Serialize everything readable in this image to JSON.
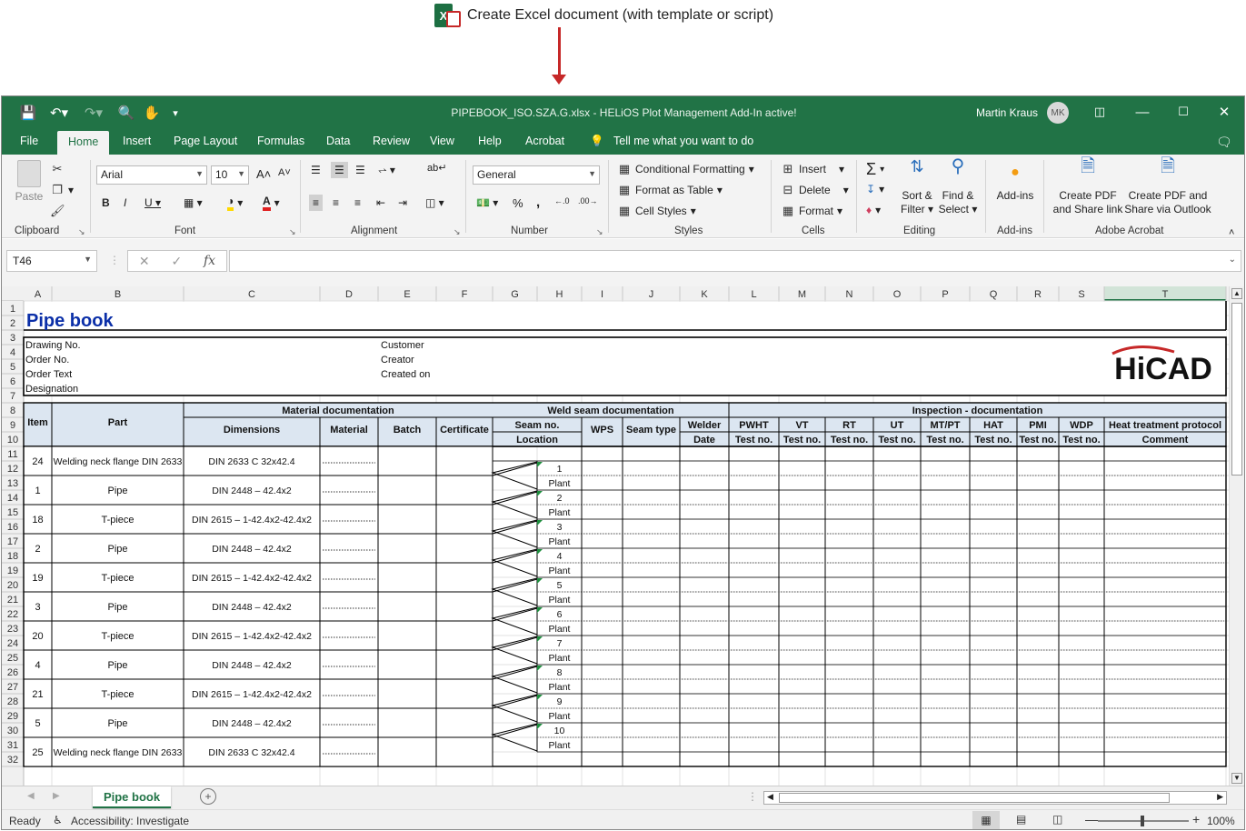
{
  "caption": {
    "text": "Create Excel document (with template or script)",
    "icon": "excel-icon"
  },
  "window": {
    "title": "PIPEBOOK_ISO.SZA.G.xlsx  -  HELiOS Plot Management Add-In active!",
    "user": "Martin Kraus",
    "avatar": "MK"
  },
  "tabs": [
    "File",
    "Home",
    "Insert",
    "Page Layout",
    "Formulas",
    "Data",
    "Review",
    "View",
    "Help",
    "Acrobat"
  ],
  "active_tab": "Home",
  "tell_me": "Tell me what you want to do",
  "ribbon": {
    "clipboard": {
      "label": "Clipboard",
      "paste": "Paste"
    },
    "font": {
      "label": "Font",
      "name": "Arial",
      "size": "10"
    },
    "alignment": {
      "label": "Alignment"
    },
    "number": {
      "label": "Number",
      "format": "General"
    },
    "styles": {
      "label": "Styles",
      "conditional": "Conditional Formatting",
      "format_table": "Format as Table",
      "cell_styles": "Cell Styles"
    },
    "cells": {
      "label": "Cells",
      "insert": "Insert",
      "delete": "Delete",
      "format": "Format"
    },
    "editing": {
      "label": "Editing",
      "sort_1": "Sort &",
      "sort_2": "Filter",
      "find_1": "Find &",
      "find_2": "Select"
    },
    "addins": {
      "label": "Add-ins",
      "button": "Add-ins"
    },
    "acrobat": {
      "label": "Adobe Acrobat",
      "pdf_share_1": "Create PDF",
      "pdf_share_2": "and Share link",
      "pdf_outlook_1": "Create PDF and",
      "pdf_outlook_2": "Share via Outlook"
    }
  },
  "formula_bar": {
    "name_box": "T46",
    "formula": ""
  },
  "columns": [
    "A",
    "B",
    "C",
    "D",
    "E",
    "F",
    "G",
    "H",
    "I",
    "J",
    "K",
    "L",
    "M",
    "N",
    "O",
    "P",
    "Q",
    "R",
    "S",
    "T"
  ],
  "selected_column": "T",
  "sheet": {
    "title": "Pipe book",
    "header_left": [
      "Drawing No.",
      "Order No.",
      "Order Text",
      "Designation"
    ],
    "header_right": [
      "Customer",
      "Creator",
      "Created on"
    ],
    "logo": "HiCAD",
    "group_headers": {
      "material": "Material documentation",
      "weld": "Weld seam documentation",
      "inspection": "Inspection - documentation"
    },
    "col_item": "Item",
    "col_part": "Part",
    "col_dimensions": "Dimensions",
    "col_material": "Material",
    "col_batch": "Batch",
    "col_certificate": "Certificate",
    "col_seam_no": "Seam no.",
    "col_location": "Location",
    "col_wps": "WPS",
    "col_seam_type": "Seam type",
    "col_welder": "Welder",
    "col_date": "Date",
    "inspections": [
      "PWHT",
      "VT",
      "RT",
      "UT",
      "MT/PT",
      "HAT",
      "PMI",
      "WDP"
    ],
    "test_no": "Test no.",
    "heat_treatment": "Heat treatment protocol",
    "comment": "Comment",
    "items": [
      {
        "item": "24",
        "part": "Welding neck flange DIN 2633",
        "dim": "DIN 2633 C 32x42.4"
      },
      {
        "item": "1",
        "part": "Pipe",
        "dim": "DIN 2448 – 42.4x2"
      },
      {
        "item": "18",
        "part": "T-piece",
        "dim": "DIN 2615 – 1-42.4x2-42.4x2"
      },
      {
        "item": "2",
        "part": "Pipe",
        "dim": "DIN 2448 – 42.4x2"
      },
      {
        "item": "19",
        "part": "T-piece",
        "dim": "DIN 2615 – 1-42.4x2-42.4x2"
      },
      {
        "item": "3",
        "part": "Pipe",
        "dim": "DIN 2448 – 42.4x2"
      },
      {
        "item": "20",
        "part": "T-piece",
        "dim": "DIN 2615 – 1-42.4x2-42.4x2"
      },
      {
        "item": "4",
        "part": "Pipe",
        "dim": "DIN 2448 – 42.4x2"
      },
      {
        "item": "21",
        "part": "T-piece",
        "dim": "DIN 2615 – 1-42.4x2-42.4x2"
      },
      {
        "item": "5",
        "part": "Pipe",
        "dim": "DIN 2448 – 42.4x2"
      },
      {
        "item": "25",
        "part": "Welding neck flange DIN 2633",
        "dim": "DIN 2633 C 32x42.4"
      }
    ],
    "seams": [
      {
        "no": "1",
        "loc": "Plant"
      },
      {
        "no": "2",
        "loc": "Plant"
      },
      {
        "no": "3",
        "loc": "Plant"
      },
      {
        "no": "4",
        "loc": "Plant"
      },
      {
        "no": "5",
        "loc": "Plant"
      },
      {
        "no": "6",
        "loc": "Plant"
      },
      {
        "no": "7",
        "loc": "Plant"
      },
      {
        "no": "8",
        "loc": "Plant"
      },
      {
        "no": "9",
        "loc": "Plant"
      },
      {
        "no": "10",
        "loc": "Plant"
      }
    ]
  },
  "sheet_tab": "Pipe book",
  "status": {
    "ready": "Ready",
    "accessibility": "Accessibility: Investigate",
    "zoom": "100%"
  }
}
